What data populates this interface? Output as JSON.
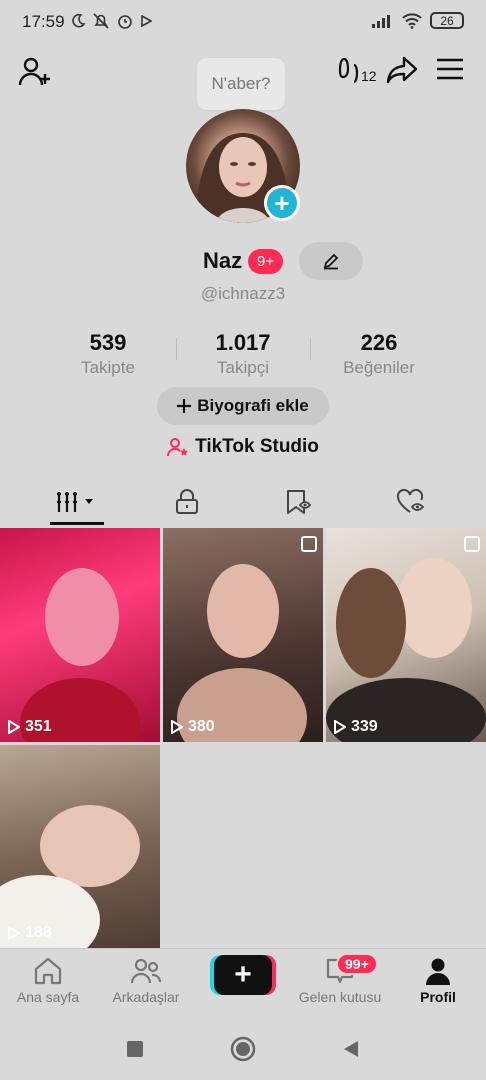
{
  "status_bar": {
    "time": "17:59",
    "battery": "26"
  },
  "header": {
    "notes_count": "12"
  },
  "tooltip": {
    "text": "N'aber?"
  },
  "profile": {
    "name": "Naz",
    "name_badge": "9+",
    "handle": "@ichnazz3"
  },
  "stats": [
    {
      "value": "539",
      "label": "Takipte"
    },
    {
      "value": "1.017",
      "label": "Takipçi"
    },
    {
      "value": "226",
      "label": "Beğeniler"
    }
  ],
  "bio_button": "Biyografi ekle",
  "studio_link": "TikTok Studio",
  "tabs": [
    {
      "icon": "videos-grid-icon"
    },
    {
      "icon": "lock-icon"
    },
    {
      "icon": "bookmark-icon"
    },
    {
      "icon": "liked-heart-icon"
    }
  ],
  "videos": [
    {
      "views": "351"
    },
    {
      "views": "380"
    },
    {
      "views": "339"
    },
    {
      "views": "188"
    }
  ],
  "bottom_nav": {
    "home": "Ana sayfa",
    "friends": "Arkadaşlar",
    "inbox": "Gelen kutusu",
    "inbox_badge": "99+",
    "profile": "Profil"
  },
  "colors": {
    "accent": "#fe2c55",
    "add_blue": "#22b4d8",
    "background": "#d9d9d9"
  }
}
